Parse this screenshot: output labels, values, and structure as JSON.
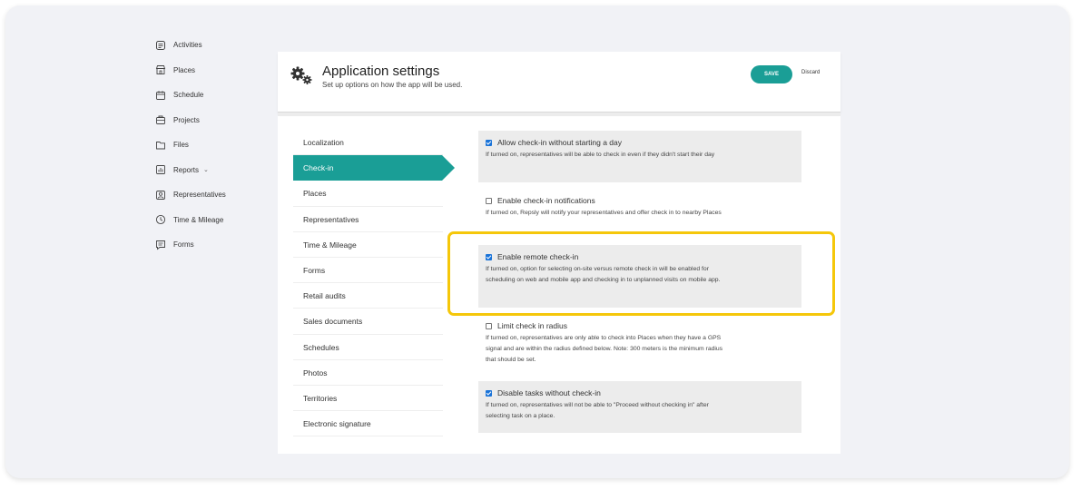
{
  "nav": {
    "items": [
      {
        "label": "Activities",
        "icon": "activities-icon"
      },
      {
        "label": "Places",
        "icon": "store-icon"
      },
      {
        "label": "Schedule",
        "icon": "calendar-icon"
      },
      {
        "label": "Projects",
        "icon": "projects-icon"
      },
      {
        "label": "Files",
        "icon": "folder-icon"
      },
      {
        "label": "Reports",
        "icon": "chart-icon",
        "chevron": "⌄"
      },
      {
        "label": "Representatives",
        "icon": "person-icon"
      },
      {
        "label": "Time & Mileage",
        "icon": "clock-icon"
      },
      {
        "label": "Forms",
        "icon": "form-icon"
      }
    ]
  },
  "header": {
    "title": "Application settings",
    "subtitle": "Set up options on how the app will be used.",
    "save_label": "SAVE",
    "discard_label": "Discard"
  },
  "submenu": {
    "items": [
      {
        "label": "Localization"
      },
      {
        "label": "Check-in",
        "active": true
      },
      {
        "label": "Places"
      },
      {
        "label": "Representatives"
      },
      {
        "label": "Time & Mileage"
      },
      {
        "label": "Forms"
      },
      {
        "label": "Retail audits"
      },
      {
        "label": "Sales documents"
      },
      {
        "label": "Schedules"
      },
      {
        "label": "Photos"
      },
      {
        "label": "Territories"
      },
      {
        "label": "Electronic signature"
      }
    ]
  },
  "options": [
    {
      "label": "Allow check-in without starting a day",
      "checked": true,
      "desc": "If turned on, representatives will be able to check in even if they didn't start their day"
    },
    {
      "label": "Enable check-in notifications",
      "checked": false,
      "desc": "If turned on, Repsly will notify your representatives and offer check in to nearby Places"
    },
    {
      "label": "Enable remote check-in",
      "checked": true,
      "desc": "If turned on, option for selecting on-site versus remote check in will be enabled for scheduling on web and mobile app and checking in to unplanned visits on mobile app."
    },
    {
      "label": "Limit check in radius",
      "checked": false,
      "desc": "If turned on, representatives are only able to check into Places when they have a GPS signal and are within the radius defined below. Note: 300 meters is the minimum radius that should be set."
    },
    {
      "label": "Disable tasks without check-in",
      "checked": true,
      "desc": "If turned on, representatives will not be able to \"Proceed without checking in\" after selecting task on a place."
    }
  ],
  "colors": {
    "accent": "#1a9e96",
    "highlight": "#f5c70a",
    "checkbox": "#1a73d8"
  }
}
